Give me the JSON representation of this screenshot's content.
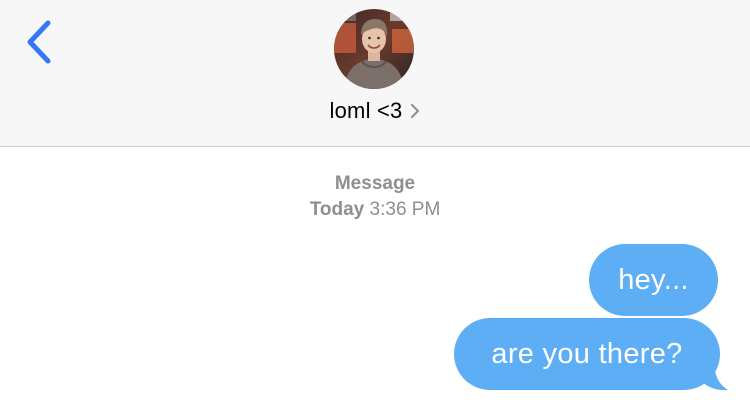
{
  "header": {
    "back_icon": "chevron-left-icon",
    "contact": {
      "name": "loml <3",
      "avatar_icon": "contact-avatar-photo",
      "disclosure_icon": "chevron-right-icon"
    }
  },
  "thread": {
    "service_label": "Message",
    "timestamp_day": "Today",
    "timestamp_time": "3:36 PM"
  },
  "messages": [
    {
      "sender": "me",
      "text": "hey..."
    },
    {
      "sender": "me",
      "text": "are you there?"
    }
  ],
  "colors": {
    "accent": "#3478f6",
    "bubble": "#5eaef5",
    "bubble_text": "#ffffff",
    "meta_text": "#8e8e93",
    "header_bg": "#f7f7f7"
  }
}
